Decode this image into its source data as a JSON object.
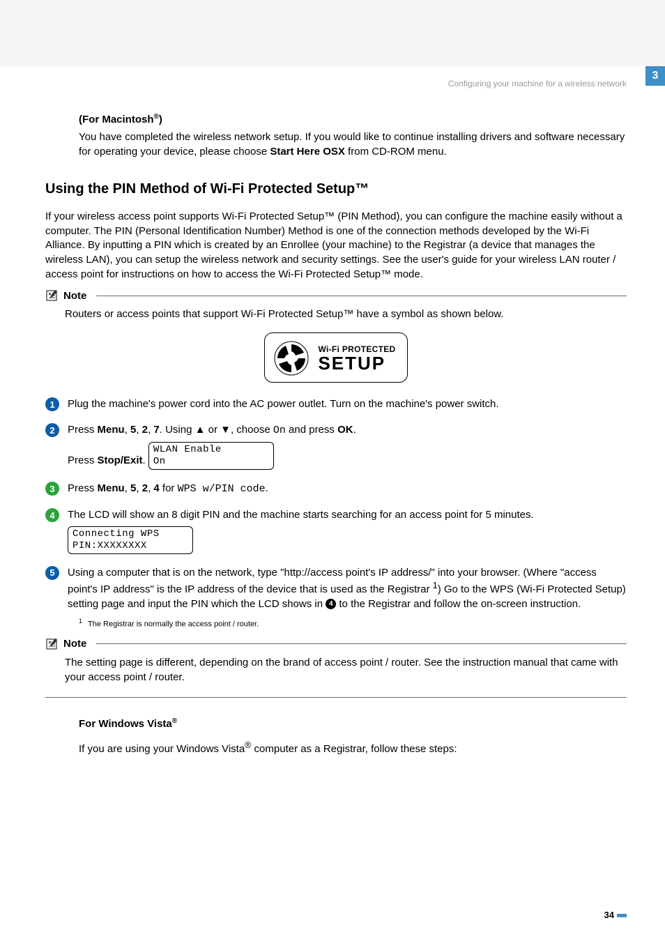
{
  "breadcrumb": "Configuring your machine for a wireless network",
  "sideTab": "3",
  "mac": {
    "heading_pre": "(For Macintosh",
    "heading_sup": "®",
    "heading_post": ")",
    "body_pre": "You have completed the wireless network setup. If you would like to continue installing drivers and software necessary for operating your device, please choose ",
    "body_bold": "Start Here OSX",
    "body_post": " from CD-ROM menu."
  },
  "heading2": "Using the PIN Method of Wi-Fi Protected Setup™",
  "intro": "If your wireless access point supports Wi-Fi Protected Setup™ (PIN Method), you can configure the machine easily without a computer. The PIN (Personal Identification Number) Method is one of the connection methods developed by the Wi-Fi Alliance. By inputting a PIN which is created by an Enrollee (your machine) to the Registrar (a device that manages the wireless LAN), you can setup the wireless network and security settings. See the user's guide for your wireless LAN router / access point for instructions on how to access the Wi-Fi Protected Setup™ mode.",
  "note1": {
    "label": "Note",
    "body": "Routers or access points that support Wi-Fi Protected Setup™ have a symbol as shown below."
  },
  "wpsLogo": {
    "line1": "Wi-Fi PROTECTED",
    "line2": "SETUP"
  },
  "steps": {
    "s1": "Plug the machine's power cord into the AC power outlet. Turn on the machine's power switch.",
    "s2": {
      "pre": "Press ",
      "b1": "Menu",
      "c1": ", ",
      "b2": "5",
      "c2": ", ",
      "b3": "2",
      "c3": ", ",
      "b4": "7",
      "mid": ". Using ▲ or ▼, choose ",
      "mono1": "On",
      "mid2": " and press ",
      "b5": "OK",
      "end": ".",
      "line2_pre": "Press ",
      "line2_bold": "Stop/Exit",
      "line2_end": ".",
      "lcd_l1": "WLAN Enable",
      "lcd_l2": "On"
    },
    "s3": {
      "pre": "Press ",
      "b1": "Menu",
      "c1": ", ",
      "b2": "5",
      "c2": ", ",
      "b3": "2",
      "c3": ", ",
      "b4": "4",
      "mid": " for ",
      "mono": "WPS w/PIN code",
      "end": "."
    },
    "s4": {
      "text": "The LCD will show an 8 digit PIN and the machine starts searching for an access point for 5 minutes.",
      "lcd_l1": "Connecting WPS",
      "lcd_l2": "PIN:XXXXXXXX"
    },
    "s5": {
      "pre": "Using a computer that is on the network, type \"http://access point's IP address/\" into your browser. (Where \"access point's IP address\" is the IP address of the device that is used as the Registrar ",
      "sup1": "1",
      "mid": ") Go to the WPS (Wi-Fi Protected Setup) setting page and input the PIN which the LCD shows in ",
      "bullet": "4",
      "post": " to the Registrar and follow the on-screen instruction.",
      "footnote_num": "1",
      "footnote": "The Registrar is normally the access point / router."
    }
  },
  "note2": {
    "label": "Note",
    "body": "The setting page is different, depending on the brand of access point / router. See the instruction manual that came with your access point / router."
  },
  "vista": {
    "heading_pre": "For Windows Vista",
    "heading_sup": "®",
    "body_pre": "If you are using your Windows Vista",
    "body_sup": "®",
    "body_post": " computer as a Registrar, follow these steps:"
  },
  "pageNumber": "34"
}
